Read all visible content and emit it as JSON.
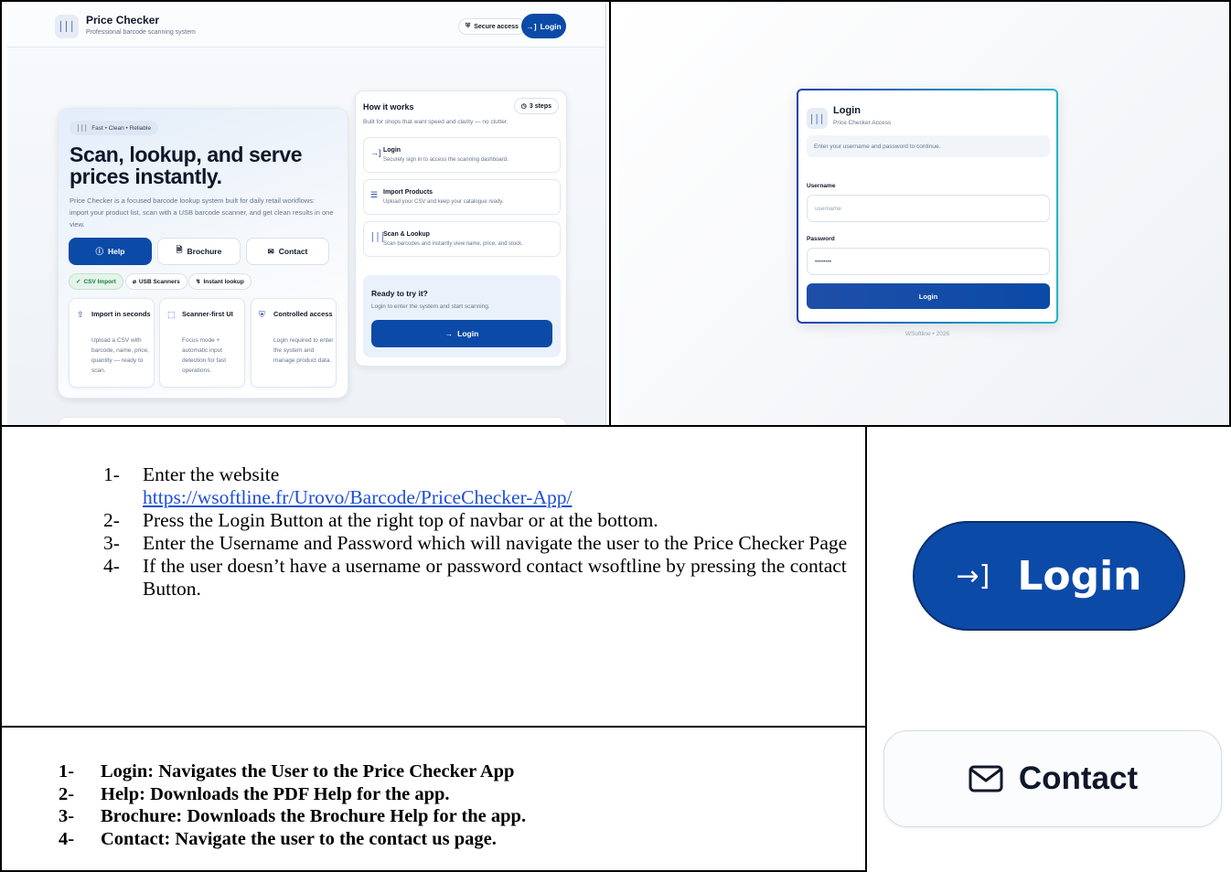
{
  "landing": {
    "brand_title": "Price Checker",
    "brand_subtitle": "Professional barcode scanning system",
    "secure_label": "Secure access",
    "login_label": "Login",
    "tag": "Fast • Clean • Reliable",
    "headline": "Scan, lookup, and serve prices instantly.",
    "intro": "Price Checker is a focused barcode lookup system built for daily retail workflows: import your product list, scan with a USB barcode scanner, and get clean results in one view.",
    "buttons": {
      "help": "Help",
      "brochure": "Brochure",
      "contact": "Contact"
    },
    "chips": {
      "csv": "CSV Import",
      "usb": "USB Scanners",
      "instant": "Instant lookup"
    },
    "features": [
      {
        "title": "Import in seconds",
        "desc": "Upload a CSV with barcode, name, price, quantity — ready to scan."
      },
      {
        "title": "Scanner-first UI",
        "desc": "Focus mode + automatic input detection for fast operations."
      },
      {
        "title": "Controlled access",
        "desc": "Login required to enter the system and manage product data."
      }
    ],
    "how": {
      "title": "How it works",
      "steps_badge": "3 steps",
      "subtitle": "Built for shops that want speed and clarity — no clutter.",
      "steps": [
        {
          "title": "Login",
          "desc": "Securely sign in to access the scanning dashboard."
        },
        {
          "title": "Import Products",
          "desc": "Upload your CSV and keep your catalogue ready."
        },
        {
          "title": "Scan & Lookup",
          "desc": "Scan barcodes and instantly view name, price, and stock."
        }
      ],
      "ready_title": "Ready to try it?",
      "ready_desc": "Login to enter the system and start scanning.",
      "ready_button": "Login"
    }
  },
  "login_page": {
    "title": "Login",
    "subtitle": "Price Checker Access",
    "notice": "Enter your username and password to continue.",
    "username_label": "Username",
    "username_placeholder": "username",
    "password_label": "Password",
    "password_value": "••••••••",
    "button": "Login",
    "footer": "WSoftline • 2026"
  },
  "instructions": [
    {
      "num": "1-",
      "text": "Enter the website",
      "link": "https://wsoftline.fr/Urovo/Barcode/PriceChecker-App/"
    },
    {
      "num": "2-",
      "text": "Press the Login Button at the right top of navbar or at the bottom."
    },
    {
      "num": "3-",
      "text": "Enter the Username and Password which will navigate the user to the Price Checker Page"
    },
    {
      "num": "4-",
      "text": "If the user doesn’t have a username or password contact wsoftline by pressing the contact Button."
    }
  ],
  "descriptions": [
    {
      "num": "1-",
      "text": "Login: Navigates the User to the Price Checker App"
    },
    {
      "num": "2-",
      "text": "Help: Downloads the PDF Help for the app."
    },
    {
      "num": "3-",
      "text": "Brochure: Downloads the Brochure Help for the app."
    },
    {
      "num": "4-",
      "text": "Contact: Navigate the user to the contact us page."
    }
  ],
  "callouts": {
    "login": "Login",
    "contact": "Contact"
  },
  "colors": {
    "primary": "#0b4aa7",
    "success": "#15803d",
    "muted": "#64748b",
    "accent_teal": "#22b5c8"
  },
  "icons": [
    "barcode-icon",
    "shield-icon",
    "login-arrow-icon",
    "help-icon",
    "file-icon",
    "mail-icon",
    "check-circle-icon",
    "usb-icon",
    "bolt-icon",
    "upload-icon",
    "scan-icon",
    "clock-icon",
    "database-icon"
  ]
}
